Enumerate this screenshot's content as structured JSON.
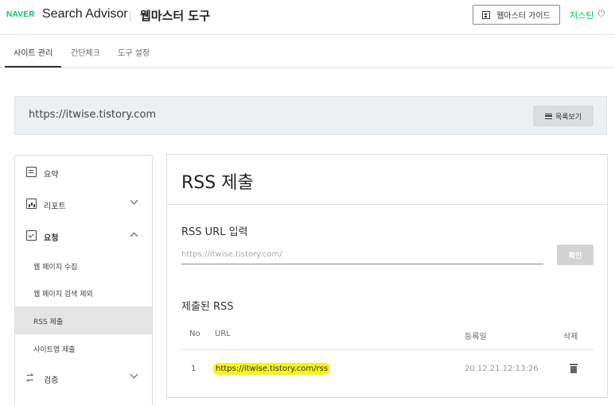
{
  "header": {
    "naver_logo": "NAVER",
    "brand": "Search Advisor",
    "tool_title": "웹마스터 도구",
    "guide_button": "웹마스터 가이드",
    "user_name": "저스틴",
    "power_icon": "power-icon"
  },
  "tabs": [
    {
      "label": "사이트 관리",
      "active": true
    },
    {
      "label": "간단체크",
      "active": false
    },
    {
      "label": "도구 설정",
      "active": false
    }
  ],
  "site": {
    "url": "https://itwise.tistory.com",
    "list_button": "목록보기"
  },
  "sidebar": {
    "items": [
      {
        "label": "요약",
        "icon": "summary-icon"
      },
      {
        "label": "리포트",
        "icon": "report-icon",
        "expanded": false
      },
      {
        "label": "요청",
        "icon": "request-icon",
        "expanded": true
      },
      {
        "label": "검증",
        "icon": "verify-icon",
        "expanded": false
      }
    ],
    "sub_items": [
      {
        "label": "웹 페이지 수집"
      },
      {
        "label": "웹 페이지 검색 제외"
      },
      {
        "label": "RSS 제출",
        "active": true
      },
      {
        "label": "사이트맵 제출"
      }
    ]
  },
  "main": {
    "title": "RSS 제출",
    "input_label": "RSS URL 입력",
    "input_placeholder": "https://itwise.tistory.com/",
    "input_value": "",
    "confirm_button": "확인",
    "submitted_label": "제출된 RSS",
    "table": {
      "headers": [
        "No",
        "URL",
        "등록일",
        "삭제"
      ],
      "rows": [
        {
          "no": "1",
          "url": "https://itwise.tistory.com/rss",
          "date": "20.12.21 12:13:26"
        }
      ]
    }
  },
  "colors": {
    "accent": "#03c75a",
    "highlight": "#f4f41a"
  }
}
